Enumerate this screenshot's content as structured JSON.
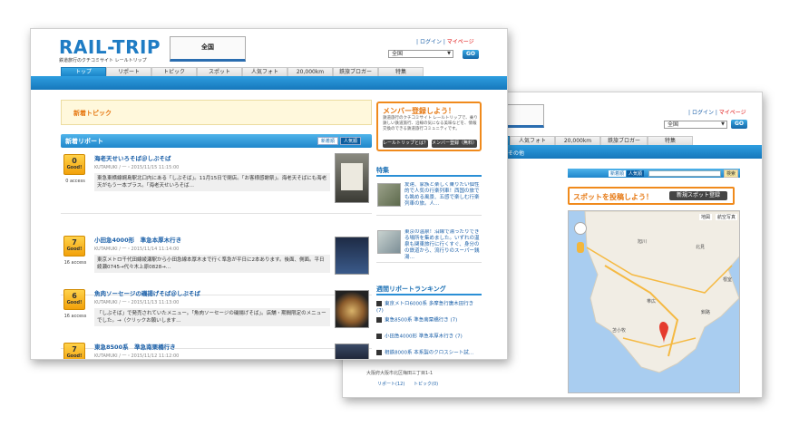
{
  "back_window": {
    "header_links": {
      "login": "ログイン",
      "mypage": "マイページ"
    },
    "area_select": "全国",
    "go_button": "GO",
    "tabs": [
      "人気フォト",
      "20,000km",
      "鉄旅ブロガー",
      "特集"
    ],
    "bluebar_left": "その他",
    "search_sort": {
      "new": "新着順",
      "popular": "人気順",
      "search_button": "検索"
    },
    "post_spot": {
      "title": "スポットを投稿しよう！",
      "button": "新規スポット登録"
    },
    "map": {
      "labels": [
        "地図",
        "航空写真"
      ],
      "places": [
        "旭川",
        "帯広",
        "釧路",
        "北見",
        "苫小牧",
        "根室"
      ]
    },
    "footer_address": "大阪府大阪市北区梅田三丁目1-1",
    "footer_links": [
      "リポート(12)",
      "トピック(0)"
    ]
  },
  "front_window": {
    "logo": "RAIL-TRIP",
    "tagline": "鉄道旅行のクチコミサイト レールトリップ",
    "area_box": "全国",
    "header_links": {
      "login": "ログイン",
      "mypage": "マイページ"
    },
    "area_select": "全国",
    "go_button": "GO",
    "tabs": [
      "トップ",
      "リポート",
      "トピック",
      "スポット",
      "人気フォト",
      "20,000km",
      "鉄旅ブロガー",
      "特集"
    ],
    "new_topic": "新着トピック",
    "new_reports": {
      "title": "新着リポート",
      "sort_new": "新着順",
      "sort_popular": "人気順"
    },
    "reports": [
      {
        "good": "0",
        "good_label": "Good!",
        "access": "0 access",
        "title": "海老天せいろそば＠しぶそば",
        "meta": "KUTAMUKI / 一・2015/11/15 11:15:00",
        "body": "東急東横線綱島駅北口内にある「しぶそば」。11月15日で閉店。「お客様感謝祭」。海老天そばにも海老天がもう一本プラス。「海老天せいろそば…"
      },
      {
        "good": "7",
        "good_label": "Good!",
        "access": "16 access",
        "title": "小田急4000形　準急本厚木行き",
        "meta": "KUTAMUKI / 一・2015/11/14 11:14:00",
        "body": "東京メトロ千代田線綾瀬駅から小田急線本厚木まで行く準急が平日に2本あります。後面、側面。平日 綾瀬0745→代々木上原0828→…"
      },
      {
        "good": "6",
        "good_label": "Good!",
        "access": "16 access",
        "title": "魚肉ソーセージの磯揚げそば＠しぶそば",
        "meta": "KUTAMUKI / 一・2015/11/13 11:13:00",
        "body": "「しぶそば」で発売されていたメニュー。「魚肉ソーセージの磯揚げそば」。店舗・期間限定のメニューでした。→（クリックお願いします…"
      },
      {
        "good": "7",
        "good_label": "Good!",
        "access": "",
        "title": "東急8500系　準急南栗橋行き",
        "meta": "KUTAMUKI / 一・2015/11/12 11:12:00",
        "body": ""
      }
    ],
    "member": {
      "title": "メンバー登録しよう！",
      "desc": "鉄道旅行のクチコミサイト レールトリップで、乗り鉄しい鉄道旅行、沿線の気になる美味などを、情報交換のできる鉄道旅行コミュニティです。",
      "btn_about": "レールトリップとは？",
      "btn_register": "メンバー登録（無料）"
    },
    "feature": {
      "title": "特集",
      "items": [
        "友達、家族と楽しく乗りたい個性的で人気の行楽列車！西国の旅でも眺める風景、五感で楽しむ行楽列車の旅。人…",
        "東京の温泉！沿線で湯ったりできる場所を集めました。いずれの温泉も関東旅行に行くすぐ、身分のの鉄道から、流行りのスーパー銭湯…"
      ]
    },
    "weekly_ranking": {
      "title": "週間リポートランキング",
      "items": [
        "東京メトロ6000系 多摩急行唐木田行き (7)",
        "東急8500系 準急南栗橋行き (7)",
        "小田急4000形 準急本厚木行き (7)",
        "相鉄8000系 本系製のクロスシート試…"
      ]
    }
  },
  "colors": {
    "accent_blue": "#1f86cb",
    "orange": "#f08a1c",
    "link": "#1a5fa8",
    "good_gold": "#f2a10a"
  }
}
